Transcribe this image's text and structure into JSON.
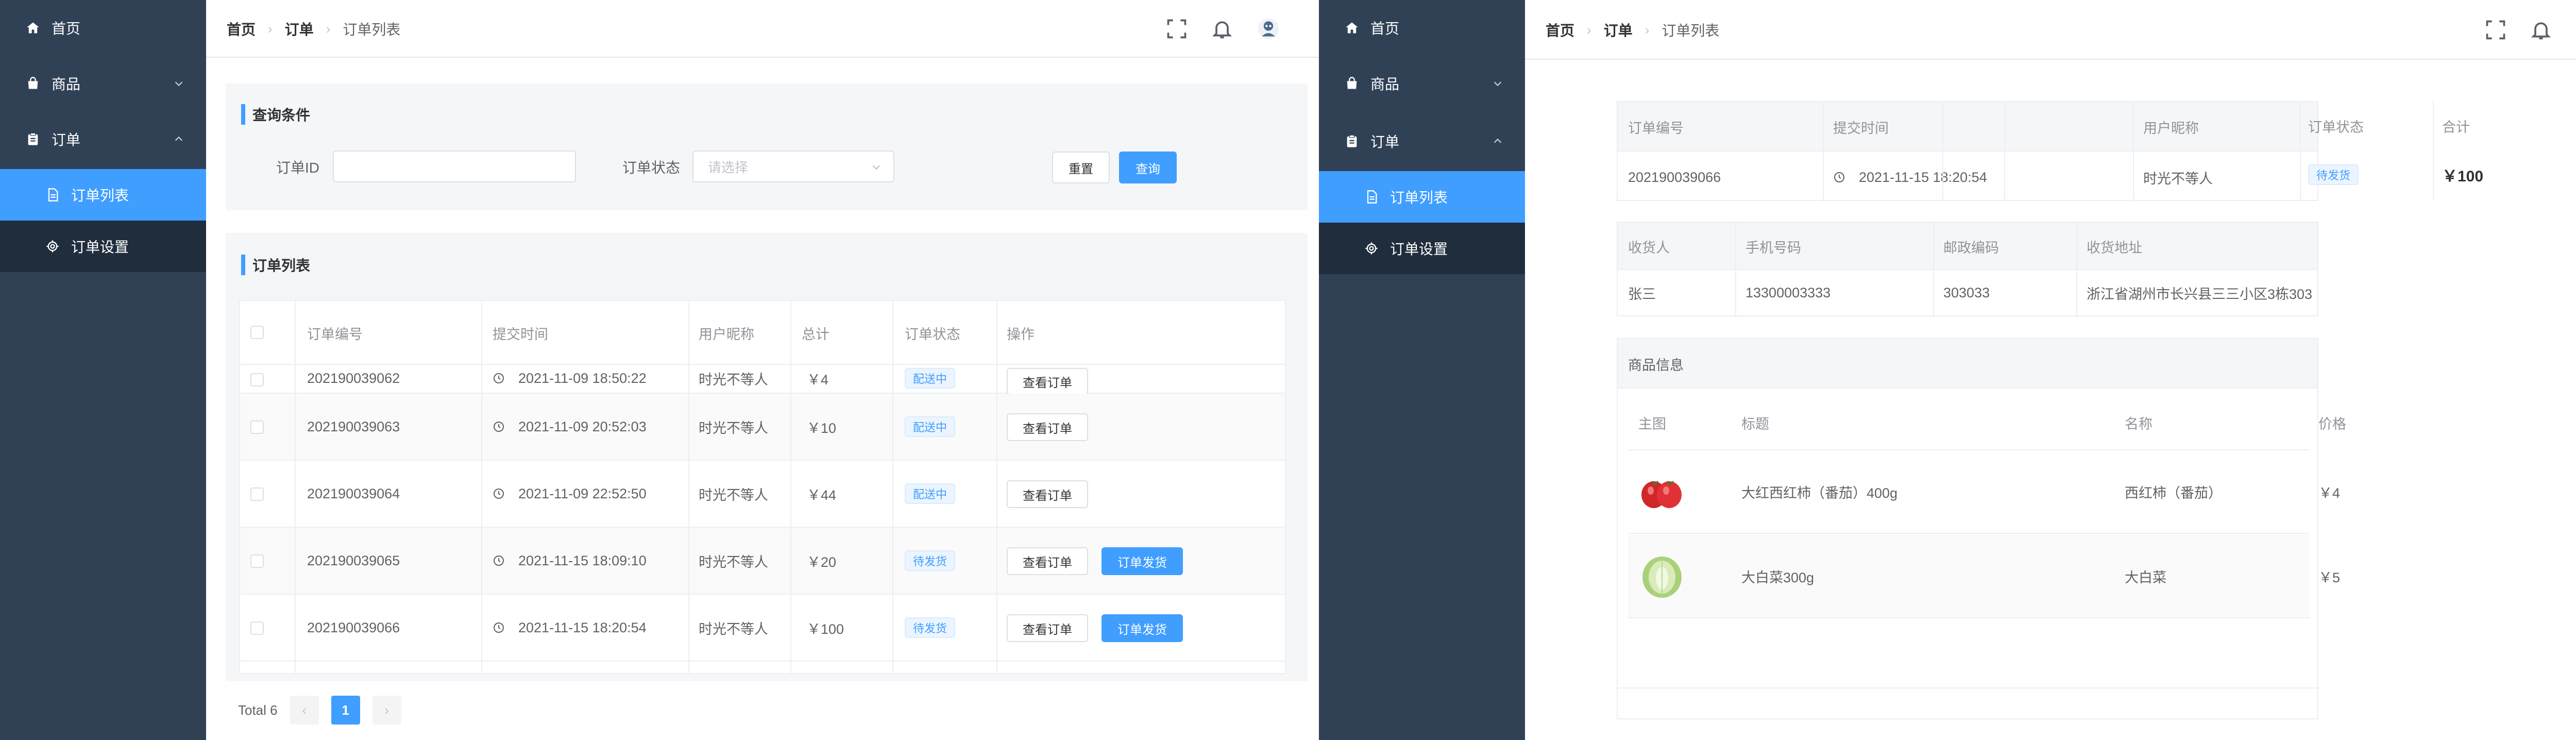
{
  "sidebar": {
    "home_label": "首页",
    "goods_label": "商品",
    "order_label": "订单",
    "order_list_label": "订单列表",
    "order_settings_label": "订单设置"
  },
  "breadcrumb": {
    "home": "首页",
    "order": "订单",
    "current": "订单列表"
  },
  "query": {
    "title": "查询条件",
    "order_id_label": "订单ID",
    "order_id_value": "",
    "status_label": "订单状态",
    "status_placeholder": "请选择",
    "reset_label": "重置",
    "search_label": "查询"
  },
  "order_list": {
    "title": "订单列表",
    "columns": [
      "订单编号",
      "提交时间",
      "用户昵称",
      "总计",
      "订单状态",
      "操作"
    ],
    "partial_row": {
      "id": "202190039062",
      "time": "2021-11-09 18:50:22",
      "user": "时光不等人",
      "total": "￥4",
      "status": "配送中",
      "view": "查看订单"
    },
    "rows": [
      {
        "id": "202190039063",
        "time": "2021-11-09 20:52:03",
        "user": "时光不等人",
        "total": "￥10",
        "status": "配送中",
        "view": "查看订单",
        "ship": ""
      },
      {
        "id": "202190039064",
        "time": "2021-11-09 22:52:50",
        "user": "时光不等人",
        "total": "￥44",
        "status": "配送中",
        "view": "查看订单",
        "ship": ""
      },
      {
        "id": "202190039065",
        "time": "2021-11-15 18:09:10",
        "user": "时光不等人",
        "total": "￥20",
        "status": "待发货",
        "view": "查看订单",
        "ship": "订单发货"
      },
      {
        "id": "202190039066",
        "time": "2021-11-15 18:20:54",
        "user": "时光不等人",
        "total": "￥100",
        "status": "待发货",
        "view": "查看订单",
        "ship": "订单发货"
      }
    ]
  },
  "pagination": {
    "total": "Total 6",
    "current": "1"
  },
  "detail": {
    "order_head": [
      "订单编号",
      "提交时间",
      "用户昵称",
      "订单状态",
      "合计"
    ],
    "order_vals": {
      "id": "202190039066",
      "time": "2021-11-15 18:20:54",
      "user": "时光不等人",
      "status": "待发货",
      "total": "￥100"
    },
    "recv_head": [
      "收货人",
      "手机号码",
      "邮政编码",
      "收货地址"
    ],
    "recv_vals": {
      "name": "张三",
      "phone": "13300003333",
      "zip": "303033",
      "address": "浙江省湖州市长兴县三三小区3栋303"
    },
    "goods_title": "商品信息",
    "goods_head": [
      "主图",
      "标题",
      "名称",
      "价格"
    ],
    "goods": [
      {
        "title": "大红西红柿（番茄）400g",
        "name": "西红柿（番茄）",
        "price": "￥4",
        "img": "tomato-image"
      },
      {
        "title": "大白菜300g",
        "name": "大白菜",
        "price": "￥5",
        "img": "cabbage-image"
      }
    ]
  },
  "colors": {
    "sidebar": "#304156",
    "sub_menu": "#1f2d3d",
    "primary": "#409eff"
  }
}
